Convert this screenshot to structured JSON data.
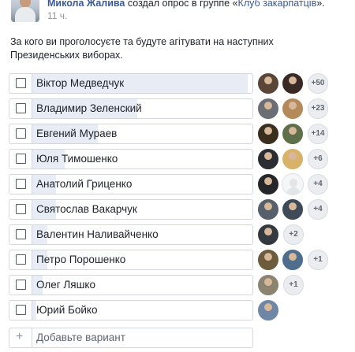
{
  "post": {
    "author": "Микола Жалива",
    "action": " создал опрос в группе «",
    "group": "Клуб закарпатців",
    "action_end": "».",
    "time": "11 ч."
  },
  "poll": {
    "question": "За кого ви проголосуєте та будуте агітувати на наступних Президенських виборах.",
    "options": [
      {
        "label": "Віктор Медведчук",
        "vote_share": 0.98,
        "more": "+50",
        "voters": [
          "#5a4636",
          "#3a2a26"
        ]
      },
      {
        "label": "Владимир Зеленский",
        "vote_share": 0.48,
        "more": "+23",
        "voters": [
          "#6b6f75",
          "#b48a5a"
        ]
      },
      {
        "label": "Евгений Мураев",
        "vote_share": 0.3,
        "more": "+14",
        "voters": [
          "#3a2e1e",
          "#5f6f4a"
        ]
      },
      {
        "label": "Юля Тимошенко",
        "vote_share": 0.15,
        "more": "+6",
        "voters": [
          "#2b2d33",
          "#d8b26a"
        ]
      },
      {
        "label": "Анатолий Гриценко",
        "vote_share": 0.11,
        "more": "+4",
        "voters": [
          "#242629",
          "placeholder"
        ]
      },
      {
        "label": "Святослав Вакарчук",
        "vote_share": 0.11,
        "more": "+4",
        "voters": [
          "#55606a",
          "#3e4a57"
        ]
      },
      {
        "label": "Валентин Наливайченко",
        "vote_share": 0.07,
        "more": "+2",
        "voters": [
          "#33393f"
        ]
      },
      {
        "label": "Петро Порошенко",
        "vote_share": 0.07,
        "more": "+1",
        "voters": [
          "#6d5b3e",
          "#4e6e8e"
        ]
      },
      {
        "label": "Олег Ляшко",
        "vote_share": 0.05,
        "more": "+1",
        "voters": [
          "#8a8470"
        ]
      },
      {
        "label": "Юрий Бойко",
        "vote_share": 0.02,
        "more": "",
        "voters": [
          "#6f86a6"
        ]
      }
    ],
    "add_placeholder": "Добавьте вариант",
    "add_icon": "+"
  }
}
